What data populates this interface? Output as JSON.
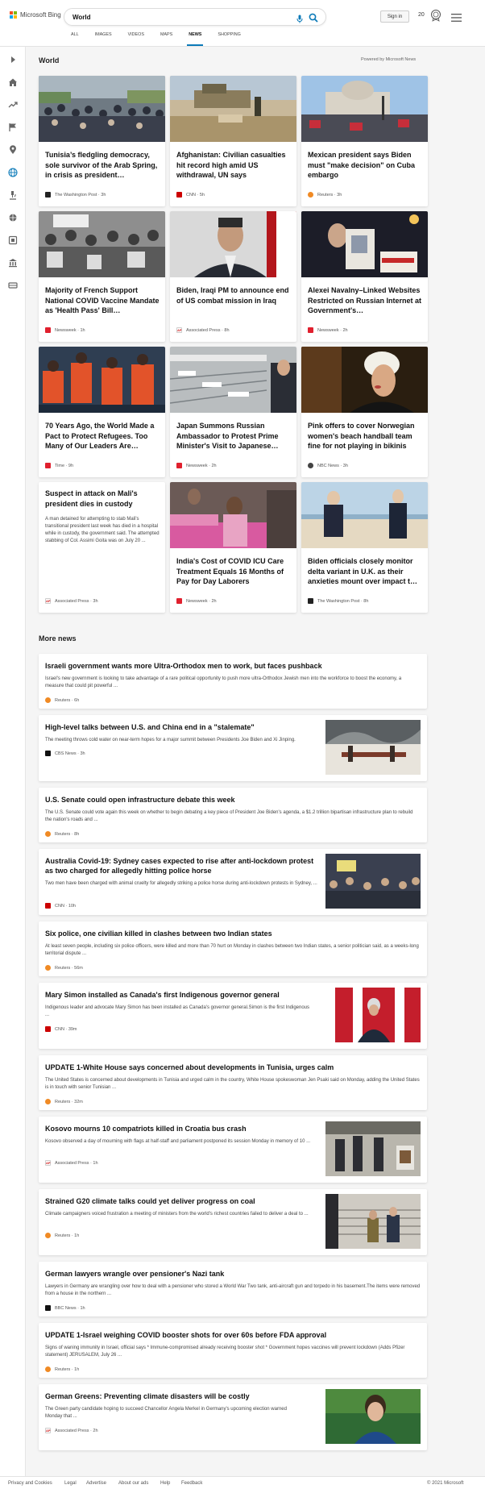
{
  "header": {
    "brand": "Microsoft Bing",
    "search_value": "World",
    "sign_in": "Sign in",
    "points": "20"
  },
  "tabs": [
    {
      "label": "ALL"
    },
    {
      "label": "IMAGES"
    },
    {
      "label": "VIDEOS"
    },
    {
      "label": "MAPS"
    },
    {
      "label": "NEWS"
    },
    {
      "label": "SHOPPING"
    }
  ],
  "section": {
    "title": "World",
    "powered": "Powered by Microsoft News"
  },
  "cards": [
    {
      "title": "Tunisia’s fledgling democracy, sole survivor of the Arab Spring, in crisis as president…",
      "source": "The Washington Post",
      "time": "3h",
      "brand_color": "#222222"
    },
    {
      "title": "Afghanistan: Civilian casualties hit record high amid US withdrawal, UN says",
      "source": "CNN",
      "time": "5h",
      "brand_color": "#cc0000"
    },
    {
      "title": "Mexican president says Biden must \"make decision\" on Cuba embargo",
      "source": "Reuters",
      "time": "3h",
      "brand_color": "#f08a24"
    },
    {
      "title": "Majority of French Support National COVID Vaccine Mandate as 'Health Pass' Bill…",
      "source": "Newsweek",
      "time": "1h",
      "brand_color": "#e0202e"
    },
    {
      "title": "Biden, Iraqi PM to announce end of US combat mission in Iraq",
      "source": "Associated Press",
      "time": "8h",
      "brand_color": "#d11a1a"
    },
    {
      "title": "Alexei Navalny–Linked Websites Restricted on Russian Internet at Government's…",
      "source": "Newsweek",
      "time": "2h",
      "brand_color": "#e0202e"
    },
    {
      "title": "70 Years Ago, the World Made a Pact to Protect Refugees. Too Many of Our Leaders Are…",
      "source": "Time",
      "time": "9h",
      "brand_color": "#e0202e"
    },
    {
      "title": "Japan Summons Russian Ambassador to Protest Prime Minister's Visit to Japanese…",
      "source": "Newsweek",
      "time": "2h",
      "brand_color": "#e0202e"
    },
    {
      "title": "Pink offers to cover Norwegian women's beach handball team fine for not playing in bikinis",
      "source": "NBC News",
      "time": "3h",
      "brand_color": "#444444"
    },
    {
      "title": "Suspect in attack on Mali's president dies in custody",
      "desc": "A man detained for attempting to stab Mali's transitional president last week has died in a hospital while in custody, the government said. The attempted stabbing of Col. Assimi Goita was on July 20 ...",
      "source": "Associated Press",
      "time": "3h",
      "brand_color": "#d11a1a"
    },
    {
      "title": "India's Cost of COVID ICU Care Treatment Equals 16 Months of Pay for Day Laborers",
      "source": "Newsweek",
      "time": "2h",
      "brand_color": "#e0202e"
    },
    {
      "title": "Biden officials closely monitor delta variant in U.K. as their anxieties mount over impact t…",
      "source": "The Washington Post",
      "time": "8h",
      "brand_color": "#222222"
    }
  ],
  "more_news": {
    "title": "More news",
    "items": [
      {
        "title": "Israeli government wants more Ultra-Orthodox men to work, but faces pushback",
        "desc": "Israel's new government is looking to take advantage of a rare political opportunity to push more ultra-Orthodox Jewish men into the workforce to boost the economy, a measure that could pit powerful ...",
        "source": "Reuters",
        "time": "6h",
        "brand_color": "#f08a24"
      },
      {
        "title": "High-level talks between U.S. and China end in a \"stalemate\"",
        "desc": "The meeting throws cold water on near-term hopes for a major summit between Presidents Joe Biden and Xi Jinping.",
        "source": "CBS News",
        "time": "3h",
        "brand_color": "#111111"
      },
      {
        "title": "U.S. Senate could open infrastructure debate this week",
        "desc": "The U.S. Senate could vote again this week on whether to begin debating a key piece of President Joe Biden's agenda, a $1.2 trillion bipartisan infrastructure plan to rebuild the nation's roads and ...",
        "source": "Reuters",
        "time": "8h",
        "brand_color": "#f08a24"
      },
      {
        "title": "Australia Covid-19: Sydney cases expected to rise after anti-lockdown protest as two charged for allegedly hitting police horse",
        "desc": "Two men have been charged with animal cruelty for allegedly striking a police horse during anti-lockdown protests in Sydney, ...",
        "source": "CNN",
        "time": "10h",
        "brand_color": "#cc0000"
      },
      {
        "title": "Six police, one civilian killed in clashes between two Indian states",
        "desc": "At least seven people, including six police officers, were killed and more than 70 hurt on Monday in clashes between two Indian states, a senior politician said, as a weeks-long territorial dispute ...",
        "source": "Reuters",
        "time": "56m",
        "brand_color": "#f08a24"
      },
      {
        "title": "Mary Simon installed as Canada's first Indigenous governor general",
        "desc": "Indigenous leader and advocate Mary Simon has been installed as Canada's governor general.Simon is the first Indigenous ...",
        "source": "CNN",
        "time": "39m",
        "brand_color": "#cc0000"
      },
      {
        "title": "UPDATE 1-White House says concerned about developments in Tunisia, urges calm",
        "desc": "The United States is concerned about developments in Tunisia and urged calm in the country, White House spokeswoman Jen Psaki said on Monday, adding the United States is in touch with senior Tunisian ...",
        "source": "Reuters",
        "time": "32m",
        "brand_color": "#f08a24"
      },
      {
        "title": "Kosovo mourns 10 compatriots killed in Croatia bus crash",
        "desc": "Kosovo observed a day of mourning with flags at half-staff and parliament postponed its session Monday in memory of 10 ...",
        "source": "Associated Press",
        "time": "1h",
        "brand_color": "#d11a1a"
      },
      {
        "title": "Strained G20 climate talks could yet deliver progress on coal",
        "desc": "Climate campaigners voiced frustration a meeting of ministers from the world's richest countries failed to deliver a deal to ...",
        "source": "Reuters",
        "time": "1h",
        "brand_color": "#f08a24"
      },
      {
        "title": "German lawyers wrangle over pensioner's Nazi tank",
        "desc": "Lawyers in Germany are wrangling over how to deal with a pensioner who stored a World War Two tank, anti-aircraft gun and torpedo in his basement.The items were removed from a house in the northern ...",
        "source": "BBC News",
        "time": "1h",
        "brand_color": "#111111"
      },
      {
        "title": "UPDATE 1-Israel weighing COVID booster shots for over 60s before FDA approval",
        "desc": "Signs of waning immunity in Israel, official says * Immune-compromised already receiving booster shot * Government hopes vaccines will prevent lockdown (Adds Pfizer statement) JERUSALEM, July 26 ...",
        "source": "Reuters",
        "time": "1h",
        "brand_color": "#f08a24"
      },
      {
        "title": "German Greens: Preventing climate disasters will be costly",
        "desc": "The Green party candidate hoping to succeed Chancellor Angela Merkel in Germany's upcoming election warned Monday that ...",
        "source": "Associated Press",
        "time": "2h",
        "brand_color": "#d11a1a"
      }
    ]
  },
  "footer": {
    "links": [
      "Privacy and Cookies",
      "Legal",
      "Advertise",
      "About our ads",
      "Help",
      "Feedback"
    ],
    "copyright": "© 2021 Microsoft"
  }
}
